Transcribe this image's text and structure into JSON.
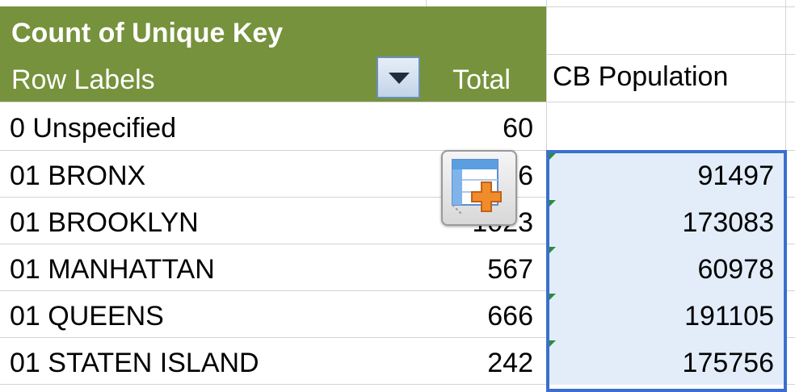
{
  "pivot": {
    "header_title": "Count of Unique Key",
    "row_labels_header": "Row Labels",
    "total_header": "Total",
    "filter_icon": "dropdown-arrow-icon"
  },
  "extra_column": {
    "header": "CB Population"
  },
  "rows": [
    {
      "label": "0 Unspecified",
      "total": "60",
      "population": ""
    },
    {
      "label": "01 BRONX",
      "total": "6",
      "population": "91497"
    },
    {
      "label": "01 BROOKLYN",
      "total": "1023",
      "population": "173083"
    },
    {
      "label": "01 MANHATTAN",
      "total": "567",
      "population": "60978"
    },
    {
      "label": "01 QUEENS",
      "total": "666",
      "population": "191105"
    },
    {
      "label": "01 STATEN ISLAND",
      "total": "242",
      "population": "175756"
    }
  ],
  "quick_analysis_icon": "quick-analysis-icon",
  "colors": {
    "pivot_header_bg": "#76923c",
    "selection_border": "#3a6fd0",
    "selection_fill": "#e3edf9",
    "error_indicator": "#2e8b3a"
  }
}
